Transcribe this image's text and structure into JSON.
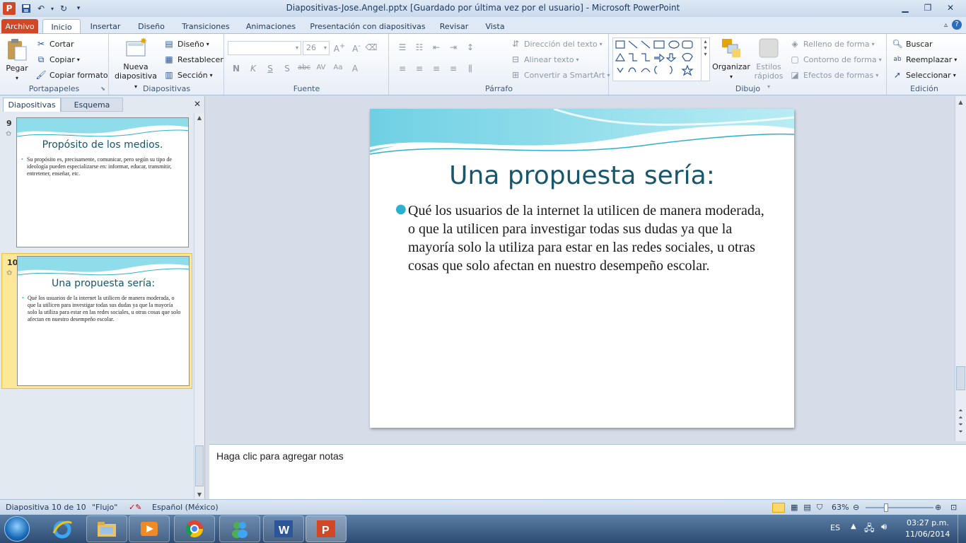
{
  "window": {
    "title": "Diapositivas-Jose.Angel.pptx [Guardado por última vez por el usuario]  -  Microsoft PowerPoint",
    "app_icon": "P"
  },
  "tabs": [
    "Archivo",
    "Inicio",
    "Insertar",
    "Diseño",
    "Transiciones",
    "Animaciones",
    "Presentación con diapositivas",
    "Revisar",
    "Vista"
  ],
  "ribbon": {
    "portapapeles": {
      "label": "Portapapeles",
      "pegar": "Pegar",
      "cortar": "Cortar",
      "copiar": "Copiar",
      "copiar_formato": "Copiar formato"
    },
    "diapositivas": {
      "label": "Diapositivas",
      "nueva_line1": "Nueva",
      "nueva_line2": "diapositiva",
      "diseno": "Diseño",
      "restablecer": "Restablecer",
      "seccion": "Sección"
    },
    "fuente": {
      "label": "Fuente",
      "font_name": "",
      "font_size": "26"
    },
    "parrafo": {
      "label": "Párrafo",
      "direccion": "Dirección del texto",
      "alinear": "Alinear texto",
      "convertir": "Convertir a SmartArt"
    },
    "dibujo": {
      "label": "Dibujo",
      "organizar": "Organizar",
      "estilos_line1": "Estilos",
      "estilos_line2": "rápidos",
      "relleno": "Relleno de forma",
      "contorno": "Contorno de forma",
      "efectos": "Efectos de formas"
    },
    "edicion": {
      "label": "Edición",
      "buscar": "Buscar",
      "reemplazar": "Reemplazar",
      "seleccionar": "Seleccionar"
    }
  },
  "panel": {
    "tab_slides": "Diapositivas",
    "tab_outline": "Esquema",
    "thumbnails": [
      {
        "number": "9",
        "title": "Propósito de los medios.",
        "body": "Su propósito  es, precisamente, comunicar, pero según su tipo de ideología pueden especializarse en: informar, educar, transmitir, entretener, enseñar, etc."
      },
      {
        "number": "10",
        "title": "Una propuesta sería:",
        "body": "Qué los usuarios de la internet la utilicen de manera moderada, o que la utilicen para investigar todas sus dudas ya que la mayoría solo la utiliza para estar en las redes sociales, u otras cosas que solo afectan en nuestro desempeño escolar."
      }
    ]
  },
  "slide": {
    "title": "Una propuesta sería:",
    "body": "Qué los usuarios de la internet la utilicen de manera moderada, o que la utilicen para investigar todas sus dudas ya que la mayoría solo la utiliza para estar en las redes sociales, u otras cosas que solo afectan en nuestro desempeño escolar.",
    "accent_color": "#2cb0cf",
    "title_color": "#17566b"
  },
  "notes": {
    "placeholder": "Haga clic para agregar notas"
  },
  "status": {
    "slide_count": "Diapositiva 10 de 10",
    "theme": "\"Flujo\"",
    "language": "Español (México)",
    "zoom": "63%"
  },
  "taskbar": {
    "lang": "ES",
    "time": "03:27 p.m.",
    "date": "11/06/2014"
  }
}
